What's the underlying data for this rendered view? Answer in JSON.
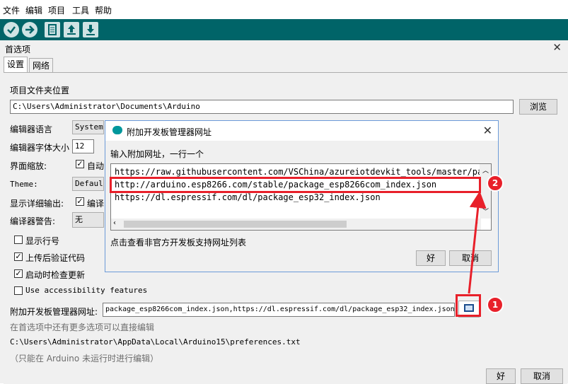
{
  "menubar": {
    "items": [
      "文件",
      "编辑",
      "项目",
      "工具",
      "帮助"
    ]
  },
  "toolbar": {
    "buttons": [
      "verify-icon",
      "upload-icon",
      "new-icon",
      "open-icon",
      "save-icon"
    ],
    "color": "#006468"
  },
  "prefs": {
    "title": "首选项",
    "tabs": [
      "设置",
      "网络"
    ],
    "sketchbook_label": "项目文件夹位置",
    "sketchbook_path": "C:\\Users\\Administrator\\Documents\\Arduino",
    "browse_label": "浏览",
    "editor_language_label": "编辑器语言",
    "editor_language_value": "System",
    "font_size_label": "编辑器字体大小",
    "font_size_value": "12",
    "scale_label": "界面缩放:",
    "scale_auto": "自动",
    "theme_label": "Theme:",
    "theme_value": "Default",
    "verbose_label": "显示详细输出:",
    "verbose_compile": "编译",
    "warnings_label": "编译器警告:",
    "warnings_value": "无",
    "show_line_numbers": "显示行号",
    "verify_after_upload": "上传后验证代码",
    "check_updates": "启动时检查更新",
    "accessibility": "Use accessibility features",
    "board_urls_label": "附加开发板管理器网址:",
    "board_urls_value": "package_esp8266com_index.json,https://dl.espressif.com/dl/package_esp32_index.json",
    "more_prefs_note": "在首选项中还有更多选项可以直接编辑",
    "prefs_path": "C:\\Users\\Administrator\\AppData\\Local\\Arduino15\\preferences.txt",
    "edit_note": "（只能在 Arduino 未运行时进行编辑）",
    "ok_label": "好",
    "cancel_label": "取消"
  },
  "modal": {
    "title": "附加开发板管理器网址",
    "instruction": "输入附加网址，一行一个",
    "urls": [
      "https://raw.githubusercontent.com/VSChina/azureiotdevkit_tools/master/package_azureboard_index.json",
      "http://arduino.esp8266.com/stable/package_esp8266com_index.json",
      "https://dl.espressif.com/dl/package_esp32_index.json"
    ],
    "unofficial_link": "点击查看非官方开发板支持网址列表",
    "ok_label": "好",
    "cancel_label": "取消"
  },
  "annotations": {
    "badge_1": "1",
    "badge_2": "2",
    "color": "#e8202a"
  }
}
